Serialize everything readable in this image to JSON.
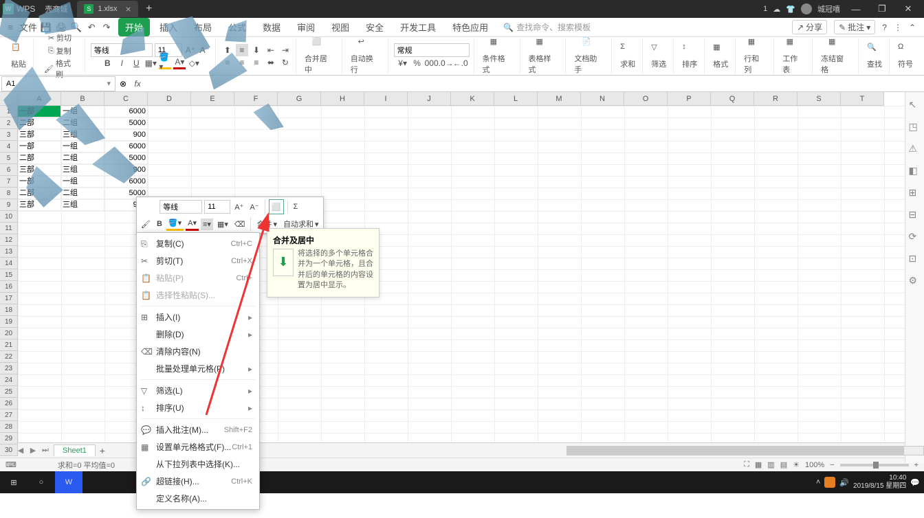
{
  "titlebar": {
    "app": "WPS",
    "tab1": "壳商城",
    "tab2": "1.xlsx",
    "user": "城冠嘻"
  },
  "menubar": {
    "file": "文件",
    "tabs": [
      "开始",
      "插入",
      "布局",
      "公式",
      "数据",
      "审阅",
      "视图",
      "安全",
      "开发工具",
      "特色应用"
    ],
    "search_ph": "查找命令、搜索模板",
    "share": "分享",
    "notes": "批注"
  },
  "ribbon": {
    "paste": "粘贴",
    "cut": "剪切",
    "copy": "复制",
    "fmtpaint": "格式刷",
    "font": "等线",
    "size": "11",
    "merge": "合并居中",
    "wrap": "自动换行",
    "numfmt": "常规",
    "condfmt": "条件格式",
    "tablestyle": "表格样式",
    "texthelper": "文档助手",
    "sum": "求和",
    "filter": "筛选",
    "sort": "排序",
    "format": "格式",
    "rowcol": "行和列",
    "worksheet": "工作表",
    "freeze": "冻结窗格",
    "find": "查找",
    "symbol": "符号"
  },
  "namebox": "A1",
  "columns": [
    "A",
    "B",
    "C",
    "D",
    "E",
    "F",
    "G",
    "H",
    "I",
    "J",
    "K",
    "L",
    "M",
    "N",
    "O",
    "P",
    "Q",
    "R",
    "S",
    "T"
  ],
  "rows": [
    1,
    2,
    3,
    4,
    5,
    6,
    7,
    8,
    9,
    10,
    11,
    12,
    13,
    14,
    15,
    16,
    17,
    18,
    19,
    20,
    21,
    22,
    23,
    24,
    25,
    26,
    27,
    28,
    29,
    30
  ],
  "data": [
    {
      "r": 0,
      "c": 0,
      "v": "一部",
      "sel": true
    },
    {
      "r": 0,
      "c": 1,
      "v": "一组"
    },
    {
      "r": 0,
      "c": 2,
      "v": "6000",
      "right": true
    },
    {
      "r": 1,
      "c": 0,
      "v": "二部"
    },
    {
      "r": 1,
      "c": 1,
      "v": "二组"
    },
    {
      "r": 1,
      "c": 2,
      "v": "5000",
      "right": true
    },
    {
      "r": 2,
      "c": 0,
      "v": "三部"
    },
    {
      "r": 2,
      "c": 1,
      "v": "三组"
    },
    {
      "r": 2,
      "c": 2,
      "v": "900",
      "right": true
    },
    {
      "r": 3,
      "c": 0,
      "v": "一部"
    },
    {
      "r": 3,
      "c": 1,
      "v": "一组"
    },
    {
      "r": 3,
      "c": 2,
      "v": "6000",
      "right": true
    },
    {
      "r": 4,
      "c": 0,
      "v": "二部"
    },
    {
      "r": 4,
      "c": 1,
      "v": "二组"
    },
    {
      "r": 4,
      "c": 2,
      "v": "5000",
      "right": true
    },
    {
      "r": 5,
      "c": 0,
      "v": "三部"
    },
    {
      "r": 5,
      "c": 1,
      "v": "三组"
    },
    {
      "r": 5,
      "c": 2,
      "v": "900",
      "right": true
    },
    {
      "r": 6,
      "c": 0,
      "v": "一部"
    },
    {
      "r": 6,
      "c": 1,
      "v": "一组"
    },
    {
      "r": 6,
      "c": 2,
      "v": "6000",
      "right": true
    },
    {
      "r": 7,
      "c": 0,
      "v": "二部"
    },
    {
      "r": 7,
      "c": 1,
      "v": "二组"
    },
    {
      "r": 7,
      "c": 2,
      "v": "5000",
      "right": true
    },
    {
      "r": 8,
      "c": 0,
      "v": "三部"
    },
    {
      "r": 8,
      "c": 1,
      "v": "三组"
    },
    {
      "r": 8,
      "c": 2,
      "v": "900",
      "right": true
    }
  ],
  "mini": {
    "font": "等线",
    "size": "11",
    "merge": "合并",
    "autosum": "自动求和"
  },
  "ctx": {
    "copy": "复制(C)",
    "copy_sc": "Ctrl+C",
    "cut": "剪切(T)",
    "cut_sc": "Ctrl+X",
    "paste": "粘贴(P)",
    "paste_sc": "Ctrl+",
    "pastesp": "选择性粘贴(S)...",
    "insert": "插入(I)",
    "delete": "删除(D)",
    "clear": "清除内容(N)",
    "batch": "批量处理单元格(P)",
    "filter": "筛选(L)",
    "sort": "排序(U)",
    "comment": "插入批注(M)...",
    "comment_sc": "Shift+F2",
    "fmtcell": "设置单元格格式(F)...",
    "fmtcell_sc": "Ctrl+1",
    "dropdown": "从下拉列表中选择(K)...",
    "hyperlink": "超链接(H)...",
    "hyperlink_sc": "Ctrl+K",
    "defname": "定义名称(A)..."
  },
  "tooltip": {
    "title": "合并及居中",
    "body": "将选择的多个单元格合并为一个单元格，且合并后的单元格的内容设置为居中显示。"
  },
  "sheet": {
    "name": "Sheet1"
  },
  "status": {
    "left": "求和=0  平均值=0  ",
    "zoom": "100%"
  },
  "clock": {
    "time": "10:40",
    "date": "2019/8/15 星期四"
  }
}
